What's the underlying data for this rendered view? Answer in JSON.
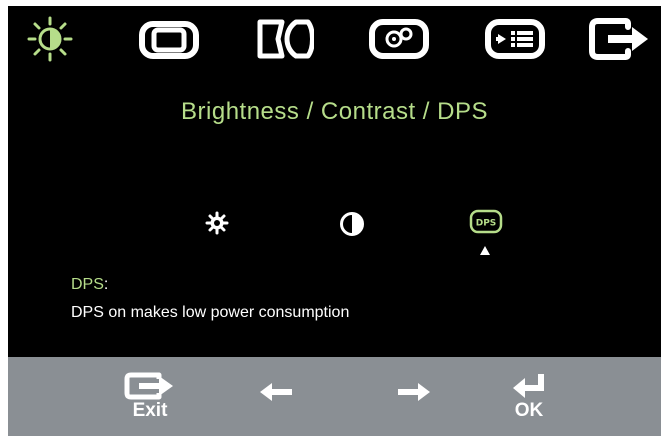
{
  "osd": {
    "tabs": [
      {
        "name": "brightness-contrast",
        "icon": "sun-icon",
        "selected": true
      },
      {
        "name": "image-position",
        "icon": "screen-position-icon",
        "selected": false
      },
      {
        "name": "image-setup",
        "icon": "image-setup-icon",
        "selected": false
      },
      {
        "name": "image-properties",
        "icon": "color-gears-icon",
        "selected": false
      },
      {
        "name": "options",
        "icon": "options-list-icon",
        "selected": false
      },
      {
        "name": "exit",
        "icon": "exit-icon",
        "selected": false
      }
    ],
    "menu_title": "Brightness / Contrast / DPS",
    "sub_items": [
      {
        "name": "brightness",
        "icon": "gear-sun-icon"
      },
      {
        "name": "contrast",
        "icon": "contrast-icon"
      },
      {
        "name": "dps",
        "icon": "dps-icon",
        "icon_text": "DPS",
        "selected": true
      }
    ],
    "description": {
      "label": "DPS",
      "colon": ":",
      "text": "DPS on makes low power consumption"
    }
  },
  "controls": {
    "exit_label": "Exit",
    "ok_label": "OK"
  },
  "colors": {
    "accent_green": "#b6dd8a",
    "osd_background": "#000000",
    "control_bar": "#8a8f94"
  }
}
